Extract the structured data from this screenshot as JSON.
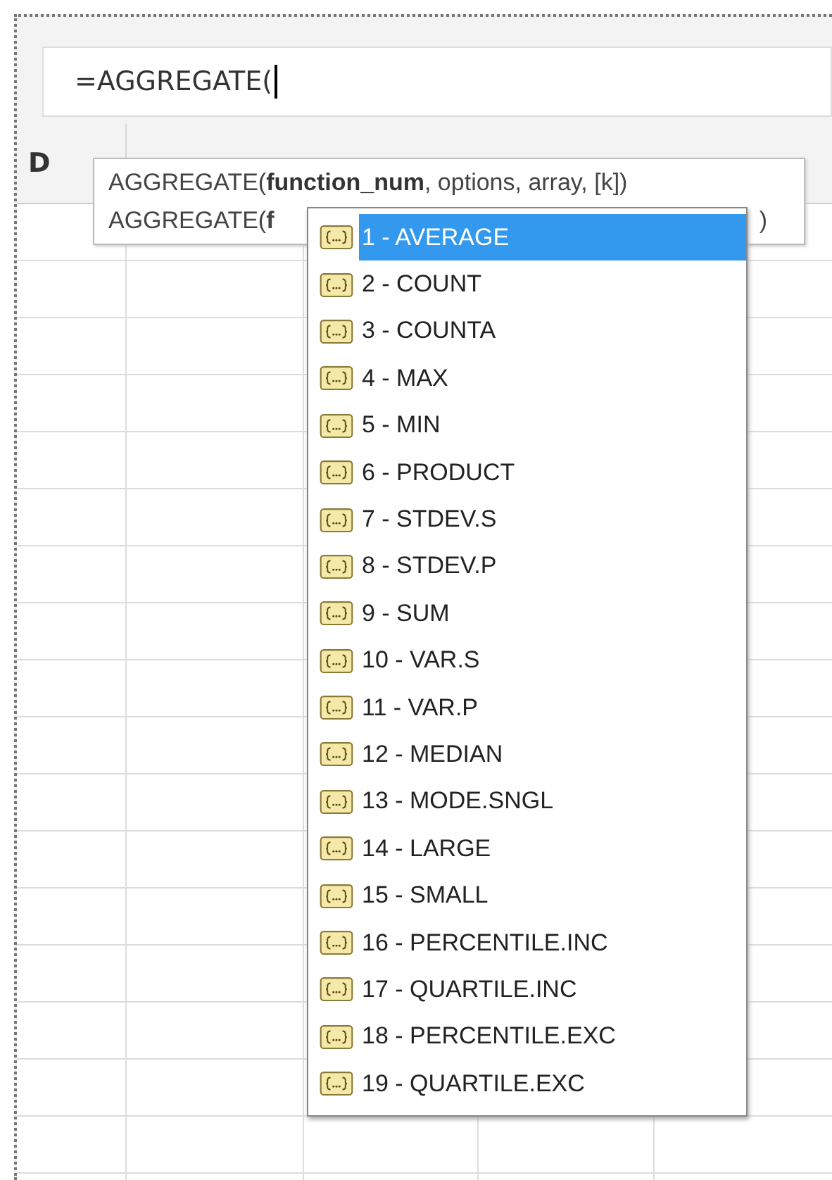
{
  "formula_bar": {
    "value": "=AGGREGATE("
  },
  "column_headers": [
    "D"
  ],
  "tooltip": {
    "signature": "AGGREGATE(**function_num**, options, array, [k])",
    "second_line_start": "AGGREGATE(**f**",
    "second_line_end": ")"
  },
  "dropdown": {
    "items": [
      {
        "label": "1 - AVERAGE",
        "selected": true
      },
      {
        "label": "2 - COUNT",
        "selected": false
      },
      {
        "label": "3 - COUNTA",
        "selected": false
      },
      {
        "label": "4 - MAX",
        "selected": false
      },
      {
        "label": "5 - MIN",
        "selected": false
      },
      {
        "label": "6 - PRODUCT",
        "selected": false
      },
      {
        "label": "7 - STDEV.S",
        "selected": false
      },
      {
        "label": "8 - STDEV.P",
        "selected": false
      },
      {
        "label": "9 - SUM",
        "selected": false
      },
      {
        "label": "10 - VAR.S",
        "selected": false
      },
      {
        "label": "11 - VAR.P",
        "selected": false
      },
      {
        "label": "12 - MEDIAN",
        "selected": false
      },
      {
        "label": "13 - MODE.SNGL",
        "selected": false
      },
      {
        "label": "14 - LARGE",
        "selected": false
      },
      {
        "label": "15 - SMALL",
        "selected": false
      },
      {
        "label": "16 - PERCENTILE.INC",
        "selected": false
      },
      {
        "label": "17 - QUARTILE.INC",
        "selected": false
      },
      {
        "label": "18 - PERCENTILE.EXC",
        "selected": false
      },
      {
        "label": "19 - QUARTILE.EXC",
        "selected": false
      }
    ]
  }
}
